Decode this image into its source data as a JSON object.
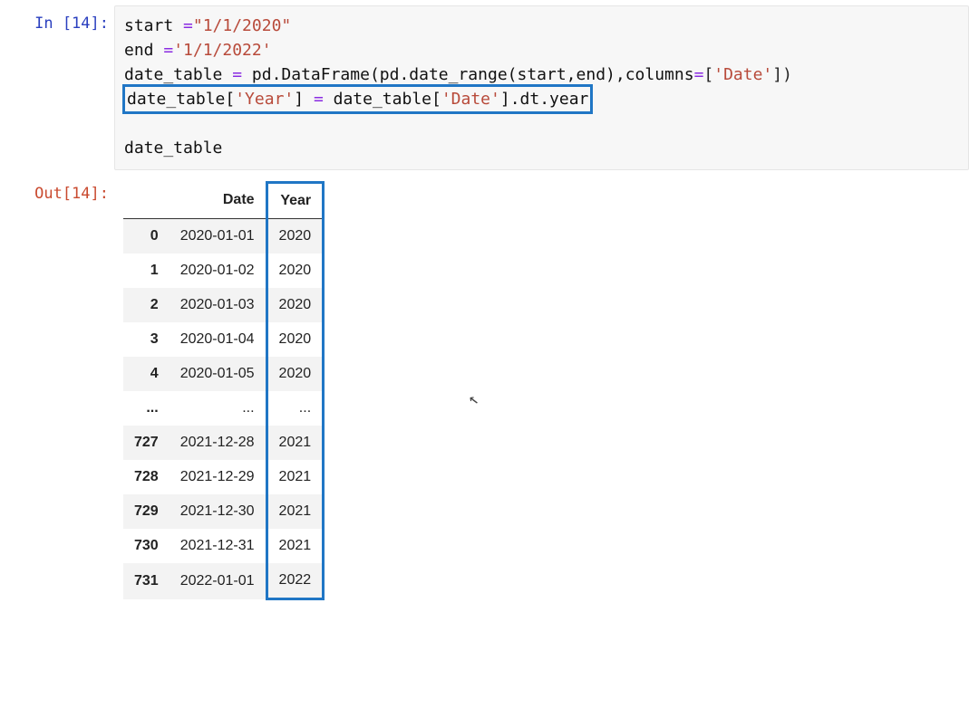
{
  "input_prompt": "In [14]:",
  "output_prompt": "Out[14]:",
  "code": {
    "kw_start": "start",
    "eq": " =",
    "str_start": "\"1/1/2020\"",
    "kw_end": "end",
    "eq2": " =",
    "str_end": "'1/1/2022'",
    "assign_dt": "date_table ",
    "eq3": "=",
    "pd_call": " pd.DataFrame(pd.date_range(start,end),columns",
    "eq4": "=",
    "brack_open": "[",
    "str_date": "'Date'",
    "brack_close": "])",
    "hl_left": "date_table[",
    "hl_year": "'Year'",
    "hl_mid": "] ",
    "hl_eq": "=",
    "hl_right": " date_table[",
    "hl_date": "'Date'",
    "hl_tail": "].dt.year",
    "blank": "",
    "final": "date_table"
  },
  "columns": {
    "c0": "",
    "c1": "Date",
    "c2": "Year"
  },
  "rows": [
    {
      "idx": "0",
      "date": "2020-01-01",
      "year": "2020"
    },
    {
      "idx": "1",
      "date": "2020-01-02",
      "year": "2020"
    },
    {
      "idx": "2",
      "date": "2020-01-03",
      "year": "2020"
    },
    {
      "idx": "3",
      "date": "2020-01-04",
      "year": "2020"
    },
    {
      "idx": "4",
      "date": "2020-01-05",
      "year": "2020"
    },
    {
      "idx": "...",
      "date": "...",
      "year": "..."
    },
    {
      "idx": "727",
      "date": "2021-12-28",
      "year": "2021"
    },
    {
      "idx": "728",
      "date": "2021-12-29",
      "year": "2021"
    },
    {
      "idx": "729",
      "date": "2021-12-30",
      "year": "2021"
    },
    {
      "idx": "730",
      "date": "2021-12-31",
      "year": "2021"
    },
    {
      "idx": "731",
      "date": "2022-01-01",
      "year": "2022"
    }
  ]
}
